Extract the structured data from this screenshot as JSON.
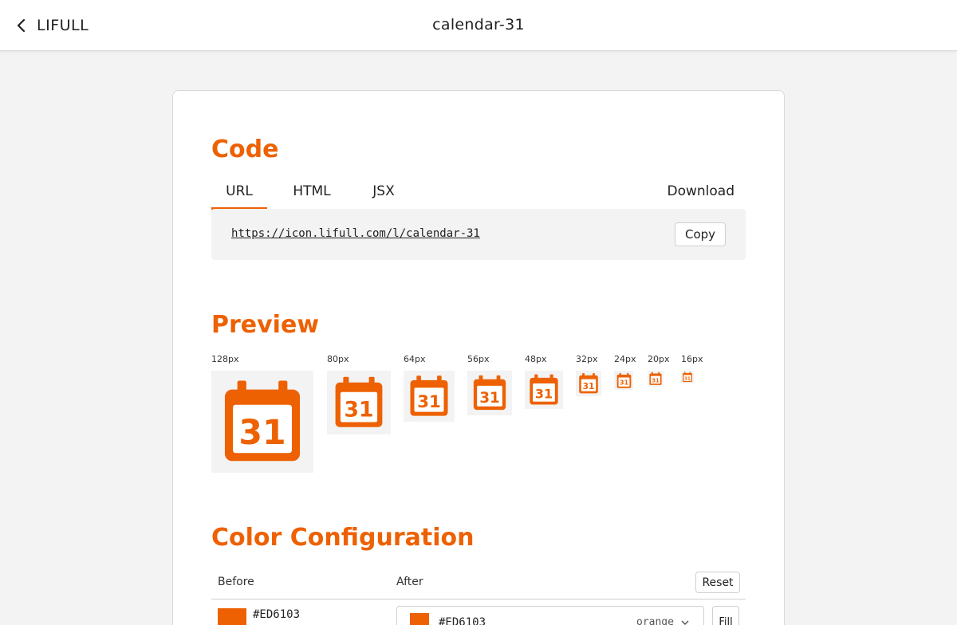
{
  "header": {
    "back_label": "LIFULL",
    "title": "calendar-31"
  },
  "code": {
    "section_title": "Code",
    "tabs": [
      {
        "label": "URL",
        "active": true
      },
      {
        "label": "HTML",
        "active": false
      },
      {
        "label": "JSX",
        "active": false
      }
    ],
    "download_label": "Download",
    "url": "https://icon.lifull.com/l/calendar-31",
    "copy_label": "Copy"
  },
  "preview": {
    "section_title": "Preview",
    "icon_text": "31",
    "sizes": [
      {
        "label": "128px",
        "size": 128
      },
      {
        "label": "80px",
        "size": 80
      },
      {
        "label": "64px",
        "size": 64
      },
      {
        "label": "56px",
        "size": 56
      },
      {
        "label": "48px",
        "size": 48
      },
      {
        "label": "32px",
        "size": 32
      },
      {
        "label": "24px",
        "size": 24
      },
      {
        "label": "20px",
        "size": 20
      },
      {
        "label": "16px",
        "size": 16
      }
    ]
  },
  "color_config": {
    "section_title": "Color Configuration",
    "before_header": "Before",
    "after_header": "After",
    "reset_label": "Reset",
    "before_hex": "#ED6103",
    "after_hex": "#ED6103",
    "after_select": "orange",
    "fill_label": "Fill"
  },
  "colors": {
    "accent": "#ED6103"
  },
  "icons": {
    "back": "chevron-left-icon",
    "preview": "calendar-31-icon",
    "dropdown": "chevron-down-icon"
  }
}
